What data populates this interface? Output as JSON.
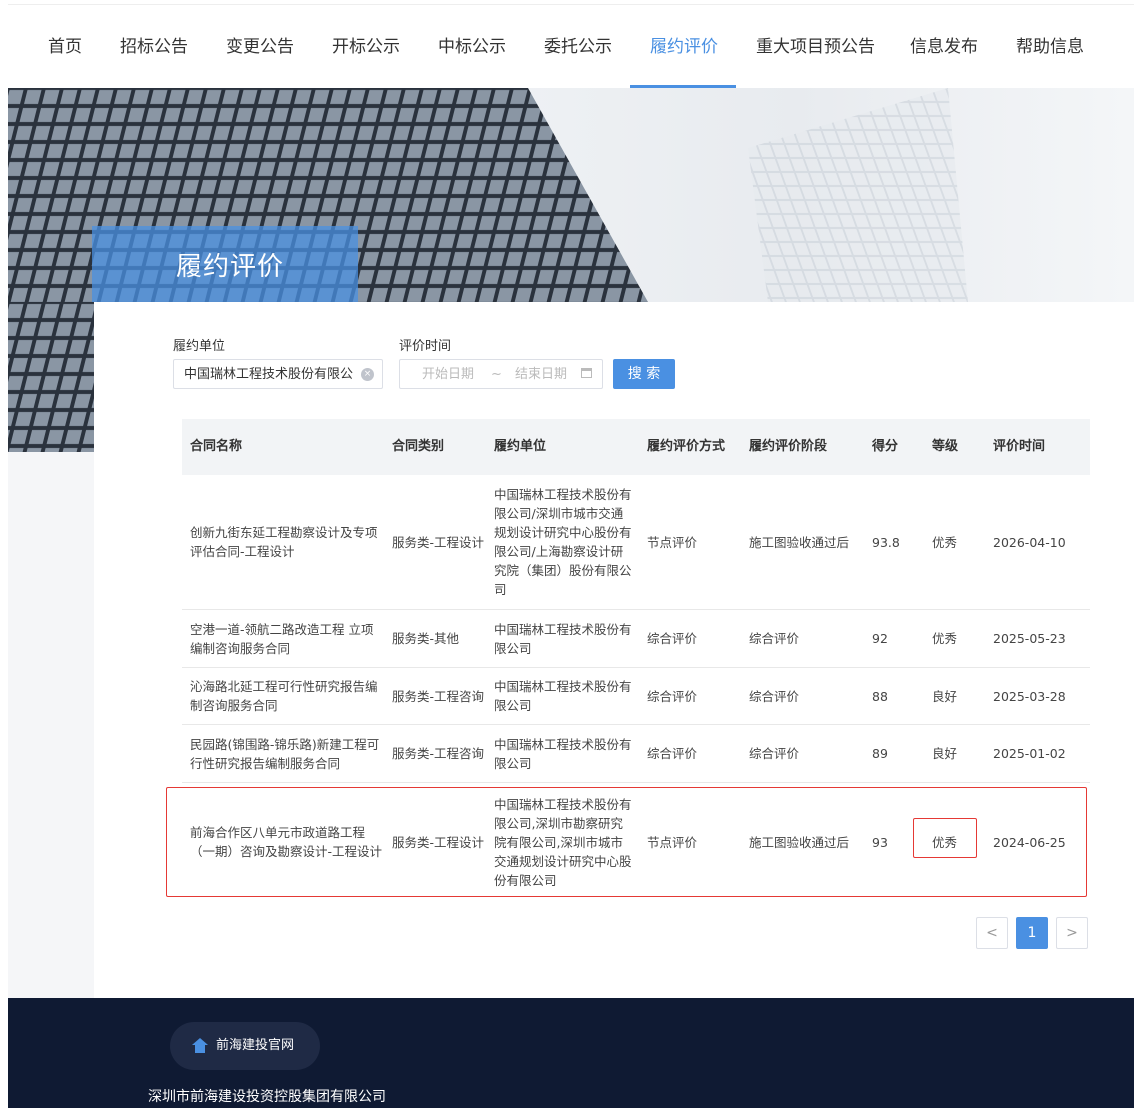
{
  "nav": {
    "items": [
      "首页",
      "招标公告",
      "变更公告",
      "开标公示",
      "中标公示",
      "委托公示",
      "履约评价",
      "重大项目预公告",
      "信息发布",
      "帮助信息"
    ],
    "active_index": 6
  },
  "hero": {
    "title": "履约评价"
  },
  "filters": {
    "unit_label": "履约单位",
    "unit_value": "中国瑞林工程技术股份有限公",
    "time_label": "评价时间",
    "start_placeholder": "开始日期",
    "separator": "~",
    "end_placeholder": "结束日期",
    "search_label": "搜 索"
  },
  "table": {
    "headers": [
      "合同名称",
      "合同类别",
      "履约单位",
      "履约评价方式",
      "履约评价阶段",
      "得分",
      "等级",
      "评价时间"
    ],
    "rows": [
      {
        "name": "创新九街东延工程勘察设计及专项评估合同-工程设计",
        "category": "服务类-工程设计",
        "unit": "中国瑞林工程技术股份有限公司/深圳市城市交通规划设计研究中心股份有限公司/上海勘察设计研究院（集团）股份有限公司",
        "method": "节点评价",
        "stage": "施工图验收通过后",
        "score": "93.8",
        "grade": "优秀",
        "date": "2026-04-10"
      },
      {
        "name": "空港一道-领航二路改造工程 立项编制咨询服务合同",
        "category": "服务类-其他",
        "unit": "中国瑞林工程技术股份有限公司",
        "method": "综合评价",
        "stage": "综合评价",
        "score": "92",
        "grade": "优秀",
        "date": "2025-05-23"
      },
      {
        "name": "沁海路北延工程可行性研究报告编制咨询服务合同",
        "category": "服务类-工程咨询",
        "unit": "中国瑞林工程技术股份有限公司",
        "method": "综合评价",
        "stage": "综合评价",
        "score": "88",
        "grade": "良好",
        "date": "2025-03-28"
      },
      {
        "name": "民园路(锦围路-锦乐路)新建工程可行性研究报告编制服务合同",
        "category": "服务类-工程咨询",
        "unit": "中国瑞林工程技术股份有限公司",
        "method": "综合评价",
        "stage": "综合评价",
        "score": "89",
        "grade": "良好",
        "date": "2025-01-02"
      },
      {
        "name": "前海合作区八单元市政道路工程（一期）咨询及勘察设计-工程设计",
        "category": "服务类-工程设计",
        "unit": "中国瑞林工程技术股份有限公司,深圳市勘察研究院有限公司,深圳市城市交通规划设计研究中心股份有限公司",
        "method": "节点评价",
        "stage": "施工图验收通过后",
        "score": "93",
        "grade": "优秀",
        "date": "2024-06-25"
      }
    ]
  },
  "pagination": {
    "prev": "<",
    "current": "1",
    "next": ">"
  },
  "footer": {
    "link_label": "前海建投官网",
    "company": "深圳市前海建设投资控股集团有限公司"
  },
  "colors": {
    "accent": "#4a90e2",
    "highlight": "#e53935",
    "footer_bg": "#0f1a33"
  }
}
